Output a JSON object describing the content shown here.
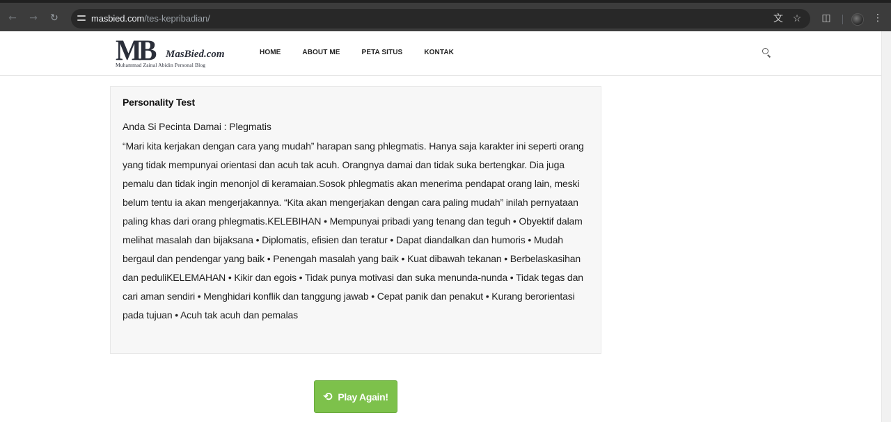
{
  "browser": {
    "url_host": "masbied.com",
    "url_path": "/tes-kepribadian/",
    "icons": [
      "back-icon",
      "forward-icon",
      "reload-icon",
      "site-info-icon",
      "translate-icon",
      "bookmark-star-icon",
      "extensions-icon",
      "profile-avatar",
      "more-menu-icon"
    ]
  },
  "site": {
    "logo_mark": "MB",
    "logo_script": "MasBied.com",
    "logo_tagline": "Muhammad Zainal Abidin Personal Blog",
    "nav": {
      "home": "HOME",
      "about": "ABOUT ME",
      "sitemap": "PETA SITUS",
      "contact": "KONTAK"
    }
  },
  "result": {
    "title": "Personality Test",
    "subtitle": "Anda Si Pecinta Damai : Plegmatis",
    "body": "“Mari kita kerjakan dengan cara yang mudah” harapan sang phlegmatis. Hanya saja karakter ini seperti orang yang tidak mempunyai orientasi dan acuh tak acuh. Orangnya damai dan tidak suka bertengkar. Dia juga pemalu dan tidak ingin menonjol di keramaian.Sosok phlegmatis akan menerima pendapat orang lain, meski belum tentu ia akan mengerjakannya. “Kita akan mengerjakan dengan cara paling mudah” inilah pernyataan paling khas dari orang phlegmatis.KELEBIHAN • Mempunyai pribadi yang tenang dan teguh • Obyektif dalam melihat masalah dan bijaksana • Diplomatis, efisien dan teratur • Dapat diandalkan dan humoris • Mudah bergaul dan pendengar yang baik • Penengah masalah yang baik • Kuat dibawah tekanan • Berbelaskasihan dan peduliKELEMAHAN • Kikir dan egois • Tidak punya motivasi dan suka menunda-nunda • Tidak tegas dan cari aman sendiri • Menghidari konflik dan tanggung jawab • Cepat panik dan penakut • Kurang berorientasi pada tujuan • Acuh tak acuh dan pemalas"
  },
  "actions": {
    "play_again": "Play Again!"
  },
  "colors": {
    "play_button": "#7dc14b",
    "card_background": "#f7f7f7",
    "browser_toolbar": "#3c3c3c"
  }
}
